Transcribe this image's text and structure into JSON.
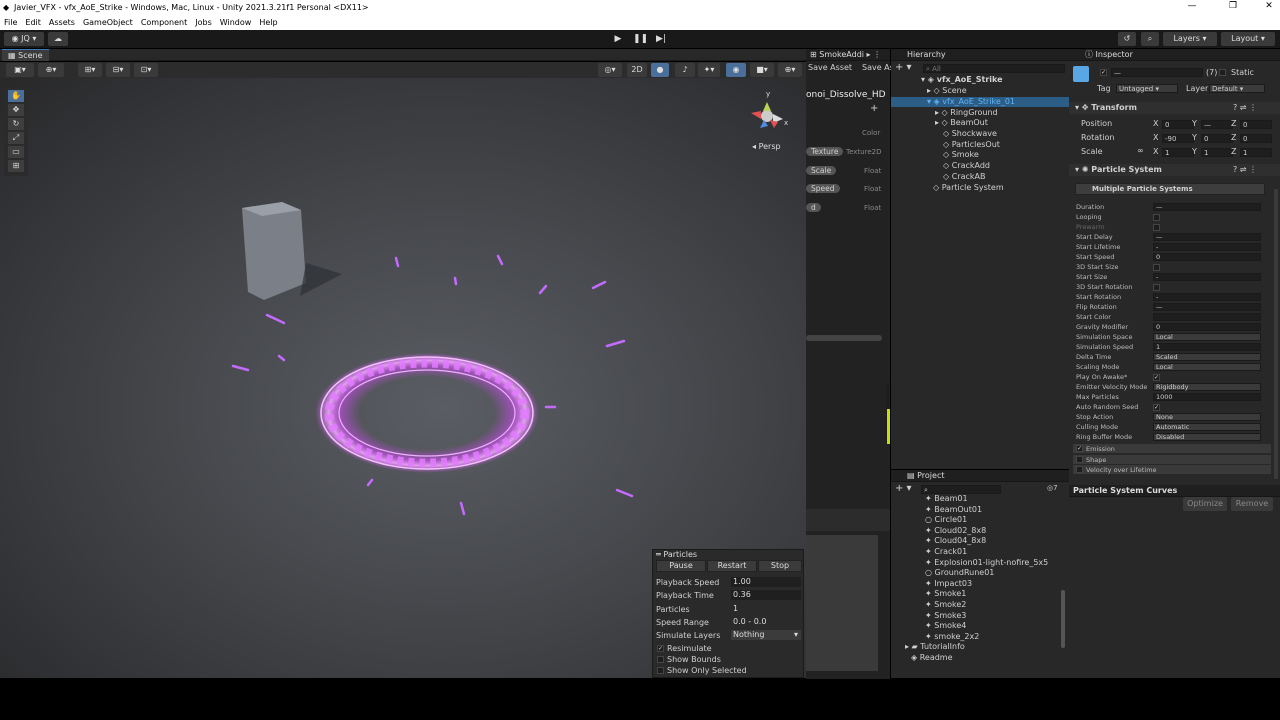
{
  "window": {
    "title": "Javier_VFX - vfx_AoE_Strike - Windows, Mac, Linux - Unity 2021.3.21f1 Personal <DX11>"
  },
  "menu": [
    "File",
    "Edit",
    "Assets",
    "GameObject",
    "Component",
    "Jobs",
    "Window",
    "Help"
  ],
  "toolbar": {
    "account": "JQ",
    "layers": "Layers",
    "layout": "Layout"
  },
  "scene": {
    "tab": "Scene",
    "persp": "Persp",
    "mode2d": "2D"
  },
  "shader": {
    "tab": "SmokeAddi",
    "save": "Save Asset",
    "saveas": "Save As",
    "name": "onoi_Dissolve_HD",
    "props": [
      {
        "name": "",
        "type": "Color"
      },
      {
        "name": "Texture",
        "type": "Texture2D"
      },
      {
        "name": "Scale",
        "type": "Float"
      },
      {
        "name": "Speed",
        "type": "Float"
      },
      {
        "name": "d",
        "type": "Float"
      }
    ]
  },
  "hierarchy": {
    "tab": "Hierarchy",
    "search": "All",
    "root": "vfx_AoE_Strike",
    "items": [
      "Scene",
      "vfx_AoE_Strike_01",
      "RingGround",
      "BeamOut",
      "Shockwave",
      "ParticlesOut",
      "Smoke",
      "CrackAdd",
      "CrackAB",
      "Particle System"
    ]
  },
  "project": {
    "tab": "Project",
    "count": "7",
    "items": [
      "Beam01",
      "BeamOut01",
      "Circle01",
      "Cloud02_8x8",
      "Cloud04_8x8",
      "Crack01",
      "Explosion01-light-nofire_5x5",
      "GroundRune01",
      "Impact03",
      "Smoke1",
      "Smoke2",
      "Smoke3",
      "Smoke4",
      "smoke_2x2",
      "TutorialInfo",
      "Readme"
    ]
  },
  "inspector": {
    "tab": "Inspector",
    "name": "—",
    "count": "(7)",
    "static": "Static",
    "tag_label": "Tag",
    "tag": "Untagged",
    "layer_label": "Layer",
    "layer": "Default",
    "transform": {
      "title": "Transform",
      "position": "Position",
      "rotation": "Rotation",
      "scale": "Scale",
      "pos": [
        "0",
        "—",
        "0"
      ],
      "rot": [
        "-90",
        "0",
        "0"
      ],
      "scl": [
        "1",
        "1",
        "1"
      ]
    },
    "ps": {
      "title": "Particle System",
      "multi": "Multiple Particle Systems",
      "props": [
        [
          "Duration",
          "—"
        ],
        [
          "Looping",
          ""
        ],
        [
          "Prewarm",
          ""
        ],
        [
          "Start Delay",
          "—"
        ],
        [
          "Start Lifetime",
          "-"
        ],
        [
          "Start Speed",
          "0"
        ],
        [
          "3D Start Size",
          ""
        ],
        [
          "Start Size",
          "-"
        ],
        [
          "3D Start Rotation",
          ""
        ],
        [
          "Start Rotation",
          "-"
        ],
        [
          "Flip Rotation",
          "—"
        ],
        [
          "Start Color",
          ""
        ],
        [
          "Gravity Modifier",
          "0"
        ],
        [
          "Simulation Space",
          "Local"
        ],
        [
          "Simulation Speed",
          "1"
        ],
        [
          "Delta Time",
          "Scaled"
        ],
        [
          "Scaling Mode",
          "Local"
        ],
        [
          "Play On Awake*",
          "✓"
        ],
        [
          "Emitter Velocity Mode",
          "Rigidbody"
        ],
        [
          "Max Particles",
          "1000"
        ],
        [
          "Auto Random Seed",
          "✓"
        ],
        [
          "Stop Action",
          "None"
        ],
        [
          "Culling Mode",
          "Automatic"
        ],
        [
          "Ring Buffer Mode",
          "Disabled"
        ]
      ],
      "modules": [
        "Emission",
        "Shape",
        "Velocity over Lifetime"
      ]
    }
  },
  "curves": {
    "title": "Particle System Curves",
    "optimize": "Optimize",
    "remove": "Remove"
  },
  "particles": {
    "title": "Particles",
    "pause": "Pause",
    "restart": "Restart",
    "stop": "Stop",
    "rows": [
      [
        "Playback Speed",
        "1.00"
      ],
      [
        "Playback Time",
        "0.36"
      ],
      [
        "Particles",
        "1"
      ],
      [
        "Speed Range",
        "0.0 - 0.0"
      ],
      [
        "Simulate Layers",
        "Nothing"
      ]
    ],
    "checks": [
      "Resimulate",
      "Show Bounds",
      "Show Only Selected"
    ]
  },
  "colors": {
    "ring": "#d94cff",
    "accent": "#3a79bb"
  }
}
